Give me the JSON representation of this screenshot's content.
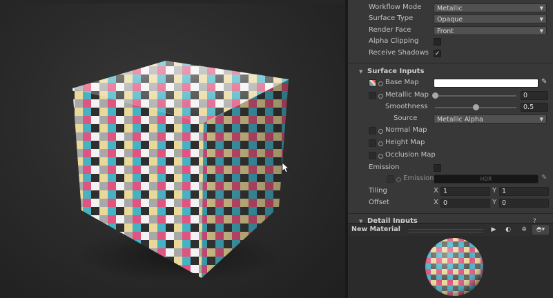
{
  "inspector": {
    "workflow_mode": {
      "label": "Workflow Mode",
      "value": "Metallic"
    },
    "surface_type": {
      "label": "Surface Type",
      "value": "Opaque"
    },
    "render_face": {
      "label": "Render Face",
      "value": "Front"
    },
    "alpha_clipping": {
      "label": "Alpha Clipping",
      "checked": false
    },
    "receive_shadows": {
      "label": "Receive Shadows",
      "checked": true,
      "check_glyph": "✓"
    },
    "surface_inputs": {
      "header": "Surface Inputs",
      "base_map": {
        "label": "Base Map",
        "color": "#ffffff"
      },
      "metallic_map": {
        "label": "Metallic Map",
        "value": "0",
        "slider_fraction": 0
      },
      "smoothness": {
        "label": "Smoothness",
        "value": "0.5",
        "slider_fraction": 0.5
      },
      "source": {
        "label": "Source",
        "value": "Metallic Alpha"
      },
      "normal_map": {
        "label": "Normal Map"
      },
      "height_map": {
        "label": "Height Map"
      },
      "occlusion_map": {
        "label": "Occlusion Map"
      },
      "emission": {
        "label": "Emission",
        "checked": false
      },
      "emission_color": {
        "label": "Emission",
        "hdr_text": "HDR",
        "color": "#000000"
      },
      "tiling": {
        "label": "Tiling",
        "x_label": "X",
        "x": "1",
        "y_label": "Y",
        "y": "1"
      },
      "offset": {
        "label": "Offset",
        "x_label": "X",
        "x": "0",
        "y_label": "Y",
        "y": "0"
      }
    },
    "detail_inputs": {
      "header": "Detail Inputs"
    }
  },
  "preview": {
    "title": "New Material"
  },
  "icons": {
    "eyedropper": "eyedropper-icon",
    "play": "play-icon",
    "sphere": "sphere-icon",
    "lighting": "lighting-icon",
    "help": "help-icon"
  }
}
